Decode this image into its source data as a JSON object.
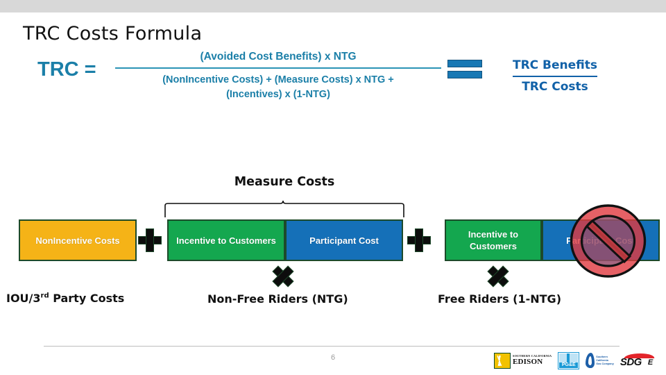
{
  "slide": {
    "title": "TRC Costs Formula",
    "page_number": "6"
  },
  "formula": {
    "lhs": "TRC =",
    "numerator": "(Avoided Cost Benefits) x NTG",
    "denominator_line1": "(NonIncentive Costs)  +  (Measure Costs) x NTG  +",
    "denominator_line2": "(Incentives) x (1-NTG)",
    "equals_icon": "equals-icon",
    "ratio_numerator": "TRC Benefits",
    "ratio_denominator": "TRC Costs",
    "accent_color": "#1b7fa8",
    "ratio_color": "#1161a8"
  },
  "diagram": {
    "bracket_label": "Measure Costs",
    "boxes": [
      {
        "label": "NonIncentive Costs",
        "color": "#f5b317",
        "name": "nonincentive-costs-box"
      },
      {
        "label": "Incentive to Customers",
        "color": "#14a74f",
        "name": "incentive-to-customers-box-1"
      },
      {
        "label": "Participant Cost",
        "color": "#1570b8",
        "name": "participant-cost-box-1"
      },
      {
        "label": "Incentive to Customers",
        "color": "#14a74f",
        "name": "incentive-to-customers-box-2"
      },
      {
        "label": "Participant Cost",
        "color": "#1570b8",
        "name": "participant-cost-box-2"
      }
    ],
    "operators": {
      "plus_1": "plus-icon",
      "plus_2": "plus-icon",
      "times_1": "multiply-icon",
      "times_2": "multiply-icon"
    },
    "excluded_marker": "no-entry-icon",
    "excluded_color": "#d9343c",
    "captions": {
      "caption_1_main": "IOU/3",
      "caption_1_sup": "rd",
      "caption_1_tail": " Party Costs",
      "caption_2": "Non-Free Riders (NTG)",
      "caption_3": "Free Riders (1-NTG)"
    }
  },
  "footer": {
    "logos": [
      {
        "name": "sce-logo",
        "small_text": "SOUTHERN CALIFORNIA",
        "big_text": "EDISON"
      },
      {
        "name": "pge-logo",
        "text": "PG&E"
      },
      {
        "name": "socalgas-logo",
        "line1": "Southern",
        "line2": "California",
        "line3": "Gas Company"
      },
      {
        "name": "sdge-logo",
        "text": "SDG",
        "text_tail": "E"
      }
    ]
  }
}
